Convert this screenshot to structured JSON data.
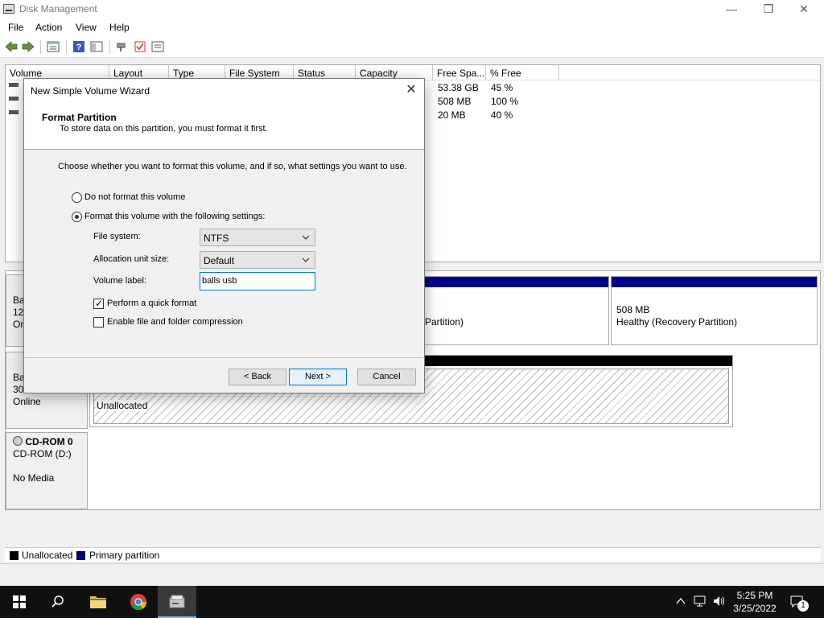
{
  "window": {
    "title": "Disk Management"
  },
  "menu": [
    "File",
    "Action",
    "View",
    "Help"
  ],
  "volume_list": {
    "columns": [
      "Volume",
      "Layout",
      "Type",
      "File System",
      "Status",
      "Capacity",
      "Free Spa...",
      "% Free"
    ],
    "rows": [
      {
        "free_space": "53.38 GB",
        "pct_free": "45 %"
      },
      {
        "free_space": "508 MB",
        "pct_free": "100 %"
      },
      {
        "free_space": "20 MB",
        "pct_free": "40 %"
      }
    ]
  },
  "disks": [
    {
      "label_lines": [
        "Ba",
        "12(",
        "On"
      ],
      "partitions": [
        {
          "lines": [
            "Partition)"
          ]
        },
        {
          "lines": [
            "508 MB",
            "Healthy (Recovery Partition)"
          ]
        }
      ]
    },
    {
      "label_lines": [
        "Ba",
        "30",
        "Online"
      ],
      "partitions": [
        {
          "lines": [
            "Unallocated"
          ]
        }
      ]
    },
    {
      "label_lines": [
        "CD-ROM 0",
        "CD-ROM (D:)",
        "",
        "No Media"
      ]
    }
  ],
  "legend": [
    {
      "label": "Unallocated",
      "color": "#000000"
    },
    {
      "label": "Primary partition",
      "color": "#00008b"
    }
  ],
  "wizard": {
    "title": "New Simple Volume Wizard",
    "heading": "Format Partition",
    "subheading": "To store data on this partition, you must format it first.",
    "intro": "Choose whether you want to format this volume, and if so, what settings you want to use.",
    "option_no_format": "Do not format this volume",
    "option_format": "Format this volume with the following settings:",
    "selected_option": "format",
    "file_system_label": "File system:",
    "file_system_value": "NTFS",
    "alloc_label": "Allocation unit size:",
    "alloc_value": "Default",
    "volume_label_label": "Volume label:",
    "volume_label_value": "balls usb",
    "quick_format_label": "Perform a quick format",
    "quick_format_checked": true,
    "compression_label": "Enable file and folder compression",
    "compression_checked": false,
    "back_button": "< Back",
    "next_button": "Next >",
    "cancel_button": "Cancel"
  },
  "taskbar": {
    "time": "5:25 PM",
    "date": "3/25/2022",
    "notification_count": "1"
  },
  "icons": {
    "app": "disk-management-icon",
    "close": "close-icon",
    "check": "✓",
    "chevron": "⌄"
  },
  "colors": {
    "primary_partition": "#00008b",
    "unallocated": "#000000",
    "accent": "#0078d7"
  }
}
